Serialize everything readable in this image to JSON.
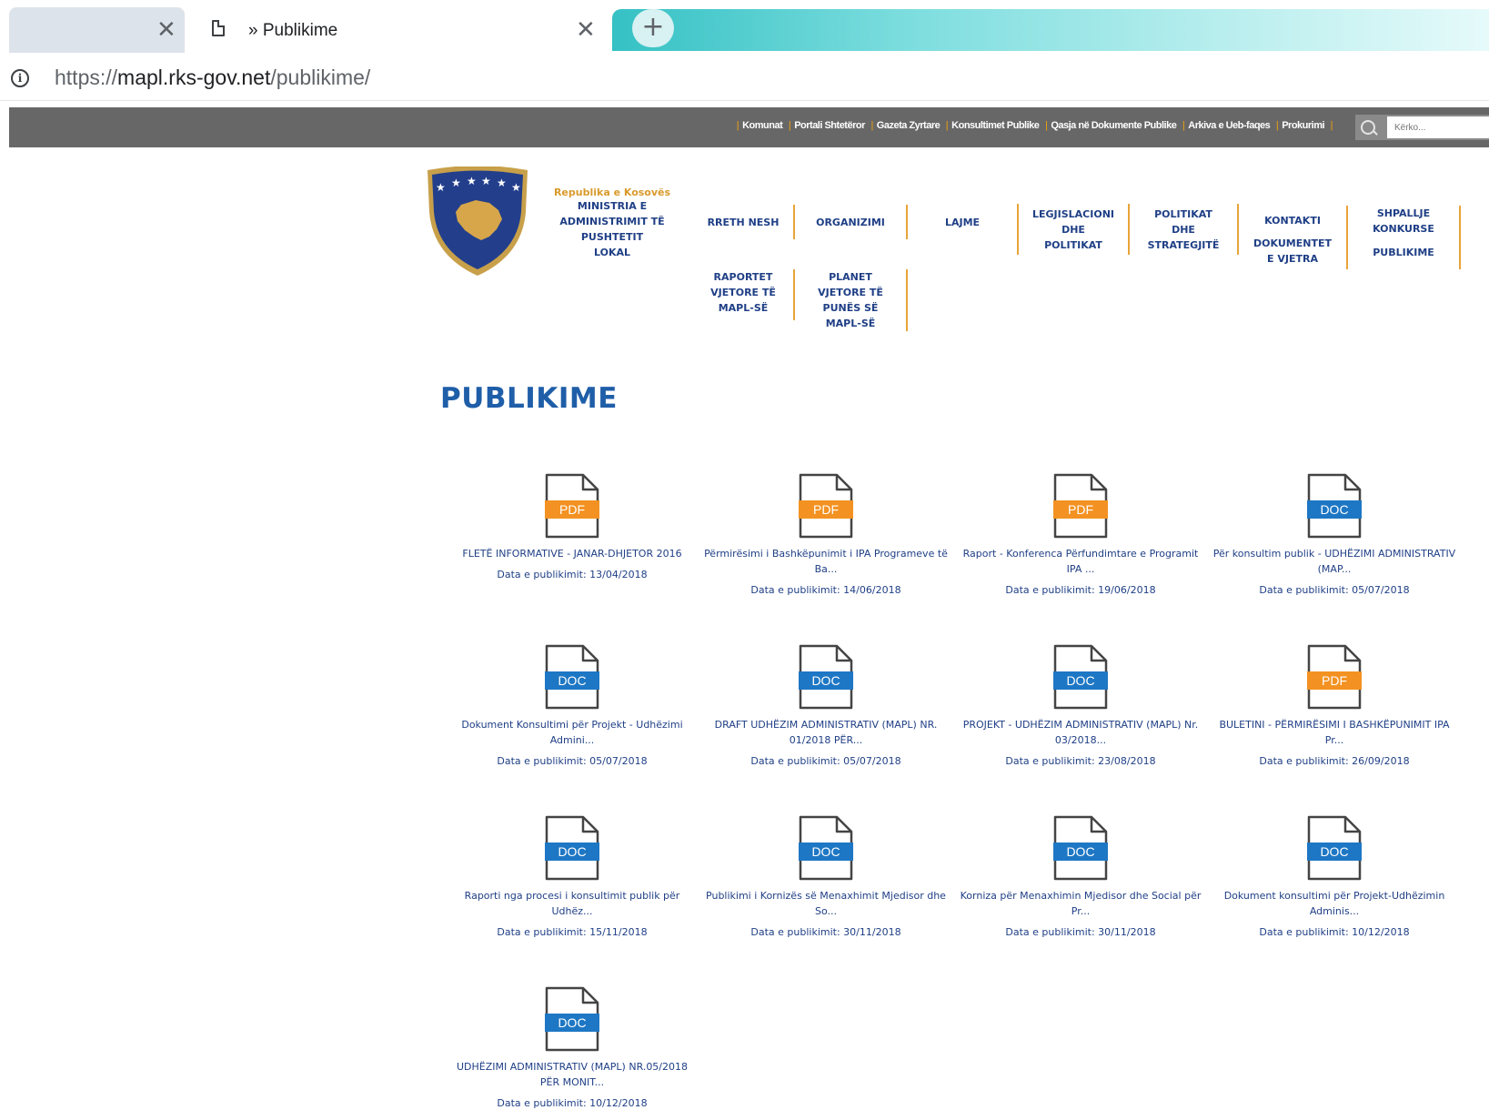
{
  "browser": {
    "active_tab_title": "» Publikime",
    "close_glyph": "✕",
    "new_tab_glyph": "+",
    "url_prefix": "https://",
    "url_domain": "mapl.rks-gov.net",
    "url_path": "/publikime/"
  },
  "topbar": {
    "links": [
      "Komunat",
      "Portali Shtetëror",
      "Gazeta Zyrtare",
      "Konsultimet Publike",
      "Qasja në Dokumente Publike",
      "Arkiva e Ueb-faqes",
      "Prokurimi"
    ],
    "search_placeholder": "Kërko..."
  },
  "header": {
    "republic": "Republika e Kosovës",
    "ministry_lines": [
      "MINISTRIA E",
      "ADMINISTRIMIT TË",
      "PUSHTETIT",
      "LOKAL"
    ]
  },
  "nav": {
    "rreth_nesh": "RRETH NESH",
    "organizimi": "ORGANIZIMI",
    "lajme": "LAJME",
    "legjislacioni": [
      "LEGJISLACIONI",
      "DHE",
      "POLITIKAT"
    ],
    "politikat": [
      "POLITIKAT",
      "DHE",
      "STRATEGJITË"
    ],
    "kontakti": "KONTAKTI",
    "dokumentet": [
      "DOKUMENTET",
      "E VJETRA"
    ],
    "shpallje": [
      "SHPALLJE",
      "KONKURSE"
    ],
    "publikime": "PUBLIKIME",
    "raportet": [
      "RAPORTET",
      "VJETORE TË",
      "MAPL-SË"
    ],
    "planet": [
      "PLANET",
      "VJETORE TË",
      "PUNËS SË",
      "MAPL-SË"
    ]
  },
  "main": {
    "title": "PUBLIKIME",
    "publications": [
      {
        "type": "PDF",
        "title": "FLETË INFORMATIVE - JANAR-DHJETOR 2016",
        "date": "Data e publikimit: 13/04/2018"
      },
      {
        "type": "PDF",
        "title": "Përmirësimi i Bashkëpunimit i IPA Programeve të Ba...",
        "date": "Data e publikimit: 14/06/2018"
      },
      {
        "type": "PDF",
        "title": "Raport - Konferenca Përfundimtare e Programit IPA ...",
        "date": "Data e publikimit: 19/06/2018"
      },
      {
        "type": "DOC",
        "title": "Për konsultim publik - UDHËZIMI ADMINISTRATIV (MAP...",
        "date": "Data e publikimit: 05/07/2018"
      },
      {
        "type": "DOC",
        "title": "Dokument Konsultimi për Projekt - Udhëzimi Admini...",
        "date": "Data e publikimit: 05/07/2018"
      },
      {
        "type": "DOC",
        "title": "DRAFT UDHËZIM ADMINISTRATIV (MAPL) NR. 01/2018 PËR...",
        "date": "Data e publikimit: 05/07/2018"
      },
      {
        "type": "DOC",
        "title": "PROJEKT - UDHËZIM ADMINISTRATIV (MAPL) Nr. 03/2018...",
        "date": "Data e publikimit: 23/08/2018"
      },
      {
        "type": "PDF",
        "title": "BULETINI - PËRMIRËSIMI I BASHKËPUNIMIT IPA Pr...",
        "date": "Data e publikimit: 26/09/2018"
      },
      {
        "type": "DOC",
        "title": "Raporti nga procesi i konsultimit publik për Udhëz...",
        "date": "Data e publikimit: 15/11/2018"
      },
      {
        "type": "DOC",
        "title": "Publikimi i Kornizës së Menaxhimit Mjedisor dhe So...",
        "date": "Data e publikimit: 30/11/2018"
      },
      {
        "type": "DOC",
        "title": "Korniza për Menaxhimin Mjedisor dhe Social për Pr...",
        "date": "Data e publikimit: 30/11/2018"
      },
      {
        "type": "DOC",
        "title": "Dokument konsultimi për Projekt-Udhëzimin Adminis...",
        "date": "Data e publikimit: 10/12/2018"
      },
      {
        "type": "DOC",
        "title": "UDHËZIMI ADMINISTRATIV (MAPL) NR.05/2018 PËR MONIT...",
        "date": "Data e publikimit: 10/12/2018"
      }
    ]
  },
  "colors": {
    "pdf": "#f39222",
    "doc": "#1e77c4",
    "navy": "#1f3f86",
    "accent": "#e8a43a",
    "topbar": "#676767"
  },
  "icons": {
    "file": "document-file-icon",
    "search": "search-icon",
    "info": "info-icon",
    "page": "page-icon"
  }
}
